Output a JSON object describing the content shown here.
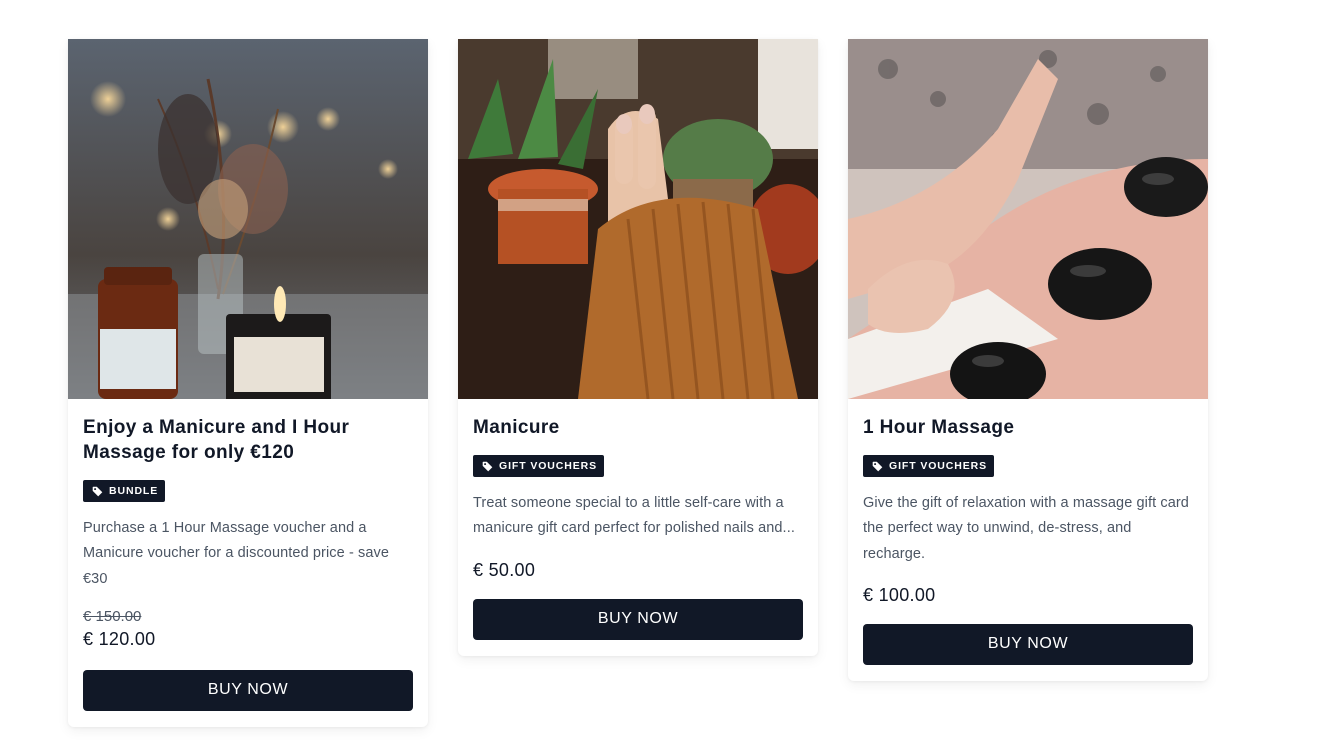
{
  "products": [
    {
      "title": "Enjoy a Manicure and I Hour Massage for only €120",
      "tag": "BUNDLE",
      "description": "Purchase a 1 Hour Massage voucher and a Manicure voucher for a discounted price - save €30",
      "old_price": "€ 150.00",
      "price": "€ 120.00",
      "button": "BUY NOW",
      "image": "candles-and-apothecary-jars-photo"
    },
    {
      "title": "Manicure",
      "tag": "GIFT VOUCHERS",
      "description": "Treat someone special to a little self-care with a manicure gift card perfect for polished nails and...",
      "price": "€ 50.00",
      "button": "BUY NOW",
      "image": "manicured-hand-with-knit-sleeve-photo"
    },
    {
      "title": "1 Hour Massage",
      "tag": "GIFT VOUCHERS",
      "description": "Give the gift of relaxation with a massage gift card the perfect way to unwind, de-stress, and recharge.",
      "price": "€ 100.00",
      "button": "BUY NOW",
      "image": "hot-stone-massage-photo"
    }
  ],
  "colors": {
    "primary": "#111827",
    "text_muted": "#4b5563",
    "background": "#ffffff"
  },
  "icons": {
    "tag": "tag-icon"
  }
}
